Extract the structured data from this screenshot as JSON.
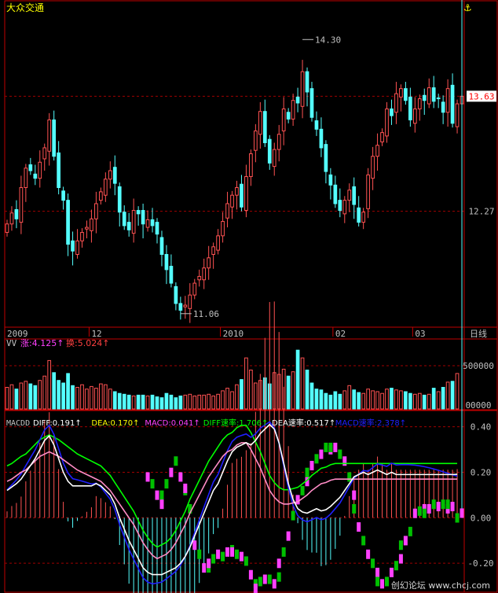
{
  "title": "大众交通",
  "colors": {
    "up": "#ff5252",
    "down": "#54ffff",
    "frame": "#c00000",
    "grid": "#a00000",
    "axis_text": "#c0c0c0",
    "title": "#ffff00",
    "diff": "#ffffff",
    "dea": "#ff8cc6",
    "macd_pos": "#ff40ff",
    "macd_neg": "#00c000",
    "speed_green": "#00ff00",
    "speed_blue": "#2020ff"
  },
  "chart_data": [
    {
      "type": "candlestick",
      "title": "大众交通",
      "y_labels": [
        "13.63",
        "12.27"
      ],
      "y_ticks": [
        13.63,
        12.27
      ],
      "ylim": [
        10.9,
        14.6
      ],
      "annotations": [
        {
          "text": "14.30",
          "value": 14.3
        },
        {
          "text": "11.06",
          "value": 11.06
        }
      ],
      "current_price": "13.63",
      "x_labels": [
        "2009",
        "12",
        "2010",
        "02",
        "03"
      ],
      "period_label": "日线",
      "x_label_index": [
        0,
        18,
        46,
        70,
        87
      ],
      "close": [
        12.12,
        12.25,
        12.18,
        12.55,
        12.78,
        12.75,
        12.66,
        12.85,
        13.02,
        13.35,
        12.92,
        12.55,
        12.4,
        11.88,
        11.8,
        11.92,
        12.02,
        12.08,
        12.18,
        12.36,
        12.5,
        12.65,
        12.75,
        12.6,
        12.26,
        12.1,
        12.05,
        12.28,
        12.24,
        12.12,
        12.17,
        12.1,
        12.0,
        11.76,
        11.58,
        11.42,
        11.18,
        11.1,
        11.16,
        11.28,
        11.42,
        11.5,
        11.6,
        11.72,
        11.85,
        11.98,
        12.15,
        12.36,
        12.46,
        12.55,
        12.32,
        12.68,
        12.95,
        13.22,
        13.45,
        13.08,
        12.84,
        13.0,
        13.18,
        13.48,
        13.36,
        13.58,
        13.55,
        13.92,
        13.68,
        13.38,
        13.24,
        13.02,
        12.74,
        12.58,
        12.36,
        12.28,
        12.4,
        12.52,
        12.35,
        12.14,
        12.26,
        12.7,
        12.92,
        13.05,
        13.2,
        13.48,
        13.4,
        13.66,
        13.72,
        13.58,
        13.35,
        13.48,
        13.6,
        13.58,
        13.73,
        13.57,
        13.6,
        13.44,
        13.72,
        13.31,
        13.54,
        13.63
      ],
      "series": [
        {
          "name": "VV",
          "label": "涨:4.125↑",
          "values": [
            250000,
            280000,
            230000,
            300000,
            320000,
            290000,
            270000,
            330000,
            380000,
            560000,
            420000,
            330000,
            300000,
            410000,
            270000,
            250000,
            280000,
            230000,
            260000,
            240000,
            290000,
            280000,
            230000,
            200000,
            180000,
            170000,
            160000,
            150000,
            160000,
            160000,
            150000,
            160000,
            140000,
            130000,
            180000,
            160000,
            130000,
            150000,
            160000,
            170000,
            150000,
            160000,
            160000,
            170000,
            150000,
            170000,
            210000,
            240000,
            200000,
            280000,
            340000,
            590000,
            450000,
            300000,
            330000,
            360000,
            290000,
            420000,
            400000,
            460000,
            380000,
            430000,
            680000,
            590000,
            450000,
            300000,
            230000,
            220000,
            180000,
            160000,
            200000,
            170000,
            210000,
            270000,
            220000,
            190000,
            180000,
            230000,
            210000,
            200000,
            180000,
            230000,
            240000,
            220000,
            210000,
            200000,
            180000,
            170000,
            180000,
            160000,
            170000,
            240000,
            200000,
            250000,
            310000,
            320000,
            410000
          ]
        },
        {
          "name": "换",
          "label": "换:5.024↑"
        }
      ],
      "volume_y_labels": [
        "500000",
        "00000"
      ],
      "volume_y_ticks": [
        500000,
        0
      ],
      "volume_ylim": [
        0,
        800000
      ]
    },
    {
      "type": "macd",
      "indicator_name": "MACDD",
      "legend": [
        {
          "text": "DIFF:0.191↑",
          "color": "#ffffff"
        },
        {
          "text": "DEA:0.170↑",
          "color": "#ffff00"
        },
        {
          "text": "MACD:0.041↑",
          "color": "#ff40ff"
        },
        {
          "text": "DIFF速率:1.706↑",
          "color": "#00ff00"
        },
        {
          "text": "DEA速率:0.517↑",
          "color": "#ffffff"
        },
        {
          "text": "MACD速率:2.378↑",
          "color": "#2020ff"
        }
      ],
      "y_labels": [
        "0.40",
        "0.20",
        "0.00",
        "-0.20"
      ],
      "y_ticks": [
        0.4,
        0.2,
        0.0,
        -0.2
      ],
      "ylim": [
        -0.3,
        0.43
      ],
      "diff": [
        0.12,
        0.135,
        0.15,
        0.17,
        0.2,
        0.23,
        0.26,
        0.3,
        0.34,
        0.36,
        0.32,
        0.26,
        0.2,
        0.16,
        0.14,
        0.14,
        0.14,
        0.14,
        0.14,
        0.15,
        0.14,
        0.12,
        0.1,
        0.06,
        0.0,
        -0.05,
        -0.1,
        -0.14,
        -0.18,
        -0.22,
        -0.24,
        -0.25,
        -0.25,
        -0.25,
        -0.24,
        -0.23,
        -0.22,
        -0.2,
        -0.17,
        -0.13,
        -0.08,
        -0.03,
        0.02,
        0.07,
        0.12,
        0.15,
        0.2,
        0.25,
        0.29,
        0.31,
        0.32,
        0.33,
        0.32,
        0.34,
        0.37,
        0.39,
        0.41,
        0.39,
        0.33,
        0.24,
        0.15,
        0.08,
        0.04,
        0.025,
        0.02,
        0.03,
        0.04,
        0.03,
        0.035,
        0.05,
        0.07,
        0.09,
        0.12,
        0.15,
        0.18,
        0.19,
        0.2,
        0.19,
        0.2,
        0.21,
        0.2,
        0.19,
        0.2,
        0.19,
        0.19,
        0.19,
        0.19,
        0.19,
        0.19,
        0.19,
        0.19,
        0.19,
        0.19,
        0.19,
        0.19,
        0.19,
        0.191
      ],
      "dea": [
        0.16,
        0.17,
        0.185,
        0.2,
        0.21,
        0.23,
        0.25,
        0.27,
        0.28,
        0.29,
        0.28,
        0.27,
        0.255,
        0.24,
        0.225,
        0.21,
        0.2,
        0.19,
        0.18,
        0.17,
        0.16,
        0.14,
        0.12,
        0.09,
        0.06,
        0.03,
        0.0,
        -0.03,
        -0.07,
        -0.11,
        -0.14,
        -0.165,
        -0.18,
        -0.17,
        -0.16,
        -0.14,
        -0.11,
        -0.07,
        -0.03,
        0.02,
        0.06,
        0.1,
        0.14,
        0.18,
        0.21,
        0.24,
        0.27,
        0.29,
        0.3,
        0.32,
        0.33,
        0.33,
        0.3,
        0.26,
        0.22,
        0.17,
        0.12,
        0.09,
        0.07,
        0.06,
        0.06,
        0.065,
        0.07,
        0.085,
        0.1,
        0.12,
        0.135,
        0.15,
        0.155,
        0.165,
        0.17,
        0.17,
        0.17,
        0.17,
        0.17,
        0.17,
        0.17,
        0.17,
        0.17,
        0.17,
        0.17,
        0.17,
        0.17,
        0.17,
        0.17,
        0.17,
        0.17,
        0.17,
        0.17,
        0.17,
        0.17,
        0.17,
        0.17,
        0.17,
        0.17,
        0.17,
        0.17
      ],
      "macd": [
        0.2,
        0.17,
        0.12,
        0.12,
        0.08,
        0.17,
        0.22,
        0.27,
        0.2,
        0.14,
        0.15,
        0.06,
        -0.1,
        -0.14,
        -0.2,
        -0.2,
        -0.18,
        -0.16,
        -0.14,
        -0.15,
        -0.13,
        -0.12,
        -0.13,
        -0.14,
        -0.15,
        -0.17,
        -0.23,
        -0.27,
        -0.29,
        -0.26,
        -0.25,
        -0.25,
        -0.27,
        -0.24,
        -0.18,
        -0.13,
        -0.06,
        0.03,
        0.1,
        0.14,
        0.18,
        0.22,
        0.25,
        0.28,
        0.3,
        0.33,
        0.32,
        0.33,
        0.33,
        0.3,
        0.27,
        0.2,
        0.12,
        0.06,
        -0.02,
        -0.08,
        -0.14,
        -0.18,
        -0.22,
        -0.26,
        -0.27,
        -0.26,
        -0.22,
        -0.19,
        -0.16,
        -0.1,
        -0.08,
        -0.04,
        0.04,
        0.05,
        0.06,
        0.04,
        0.06,
        0.08,
        0.07,
        0.08,
        0.06,
        0.08,
        0.07,
        0.02,
        0.041
      ],
      "macd_window": [
        30,
        97
      ]
    }
  ]
}
